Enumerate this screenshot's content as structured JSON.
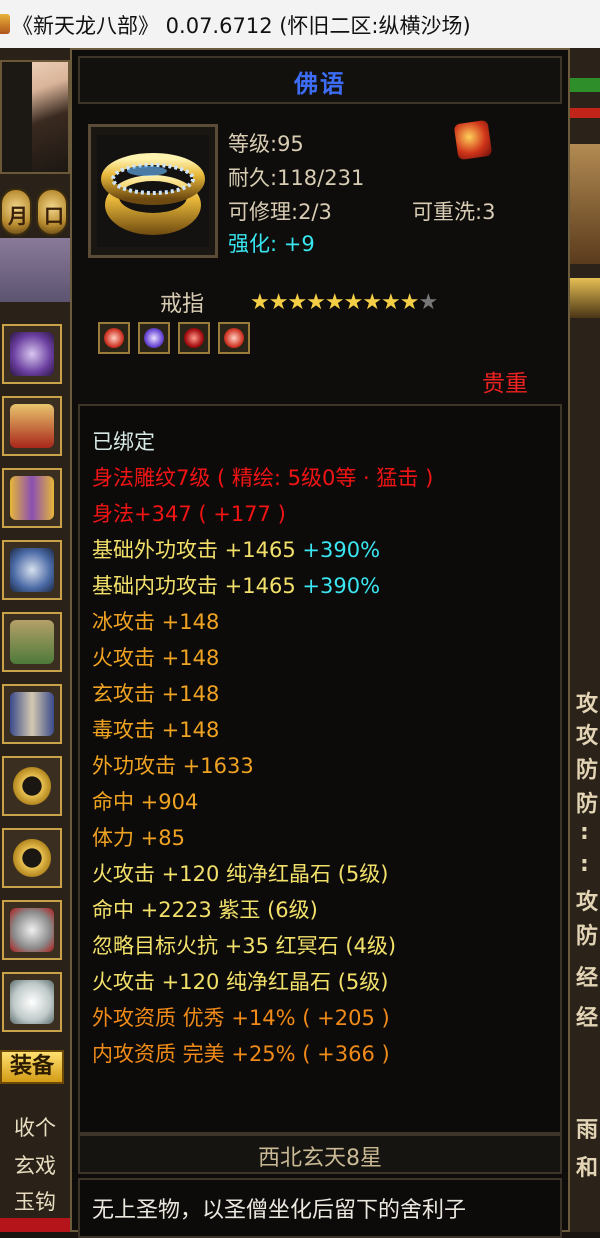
{
  "window": {
    "title": "《新天龙八部》 0.07.6712 (怀旧二区:纵横沙场)"
  },
  "background": {
    "mini_buttons": [
      "月",
      "口"
    ],
    "equip_tab": "装备",
    "left_texts": [
      "收个",
      "玄戏",
      "玉钩"
    ],
    "right_texts": [
      "攻",
      "攻",
      "防",
      "防",
      ":",
      ":",
      "攻",
      "防",
      "经",
      "经",
      "雨",
      "和"
    ]
  },
  "tooltip": {
    "title": "佛语",
    "stats": {
      "level": "等级:95",
      "durability": "耐久:118/231",
      "repairable": "可修理:2/3",
      "rewash": "可重洗:3",
      "enhance_label": "强化: ",
      "enhance_value": "+9"
    },
    "item_type": "戒指",
    "stars": {
      "filled": 9,
      "total": 10
    },
    "gems": [
      "red-gem",
      "purple-gem",
      "red-dark-gem",
      "red-gem"
    ],
    "rarity": "贵重",
    "attributes": [
      {
        "text": "已绑定",
        "color": "white"
      },
      {
        "text": "身法雕纹7级 ( 精绘: 5级0等 · 猛击 )",
        "color": "red"
      },
      {
        "text": "身法+347 ( +177 )",
        "color": "red"
      },
      {
        "text": "基础外功攻击 +1465",
        "extra": "+390%",
        "color": "yellow"
      },
      {
        "text": "基础内功攻击 +1465",
        "extra": "+390%",
        "color": "yellow"
      },
      {
        "text": "冰攻击 +148",
        "color": "gold"
      },
      {
        "text": "火攻击 +148",
        "color": "gold"
      },
      {
        "text": "玄攻击 +148",
        "color": "gold"
      },
      {
        "text": "毒攻击 +148",
        "color": "gold"
      },
      {
        "text": "外功攻击 +1633",
        "color": "gold"
      },
      {
        "text": "命中 +904",
        "color": "gold"
      },
      {
        "text": "体力 +85",
        "color": "gold"
      },
      {
        "text": "火攻击 +120 纯净红晶石 (5级)",
        "color": "yellow"
      },
      {
        "text": "命中 +2223 紫玉 (6级)",
        "color": "yellow"
      },
      {
        "text": "忽略目标火抗 +35 红冥石 (4级)",
        "color": "yellow"
      },
      {
        "text": "火攻击 +120 纯净红晶石 (5级)",
        "color": "yellow"
      },
      {
        "text": "外攻资质  优秀 +14% ( +205 )",
        "color": "orange"
      },
      {
        "text": "内攻资质  完美 +25% ( +366 )",
        "color": "orange"
      }
    ],
    "set_name": "西北玄天8星",
    "description": "无上圣物，以圣僧坐化后留下的舍利子"
  }
}
